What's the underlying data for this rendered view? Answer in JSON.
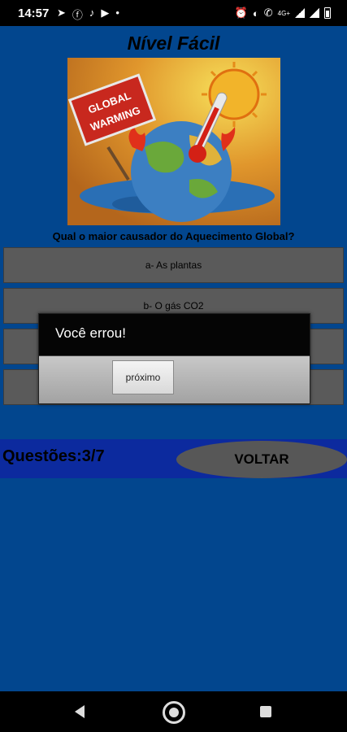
{
  "status_bar": {
    "time": "14:57",
    "left_icons": [
      "telegram-icon",
      "facebook-icon",
      "tiktok-icon",
      "youtube-icon",
      "dot-icon"
    ],
    "right_icons": [
      "alarm-icon",
      "data-saver-icon",
      "wifi-calling-icon",
      "4g-icon",
      "signal-icon",
      "signal-icon",
      "battery-icon"
    ],
    "network_label": "4G+"
  },
  "app": {
    "level_title": "Nível Fácil",
    "image_alt_text": [
      "GLOBAL",
      "WARMING"
    ],
    "question": "Qual o maior causador do Aquecimento Global?",
    "answers": [
      {
        "label": "a- As plantas"
      },
      {
        "label": "b- O gás CO2"
      },
      {
        "label": ""
      },
      {
        "label": ""
      }
    ],
    "score_label": "Questões:3/7",
    "back_label": "VOLTAR"
  },
  "dialog": {
    "title": "Você errou!",
    "next_label": "próximo"
  },
  "colors": {
    "background": "#02468e",
    "answer_bg": "#5a5a5a",
    "score_bar": "#0c2a9e",
    "back_button": "#575757"
  }
}
